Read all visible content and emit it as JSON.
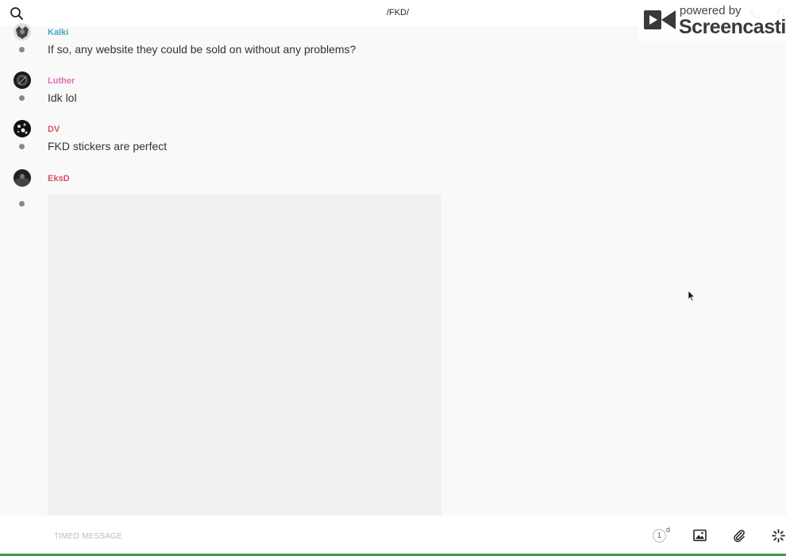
{
  "header": {
    "title": "/FKD/",
    "search_icon": "search-icon",
    "phone_icon": "phone-icon",
    "info_icon": "info-icon"
  },
  "watermark": {
    "top": "powered by",
    "bottom": "Screencastify"
  },
  "messages": [
    {
      "author": "Kalki",
      "author_color": "#4aa6c9",
      "text": "If so, any website they could be sold on without any problems?"
    },
    {
      "author": "Luther",
      "author_color": "#e36bb3",
      "text": "Idk lol"
    },
    {
      "author": "DV",
      "author_color": "#d6555f",
      "text": "FKD stickers are perfect"
    },
    {
      "author": "EksD",
      "author_color": "#d6555f",
      "text": ""
    }
  ],
  "composer": {
    "placeholder": "TIMED MESSAGE",
    "timer_value": "1",
    "timer_unit": "d",
    "photo_icon": "photo-icon",
    "attach_icon": "paperclip-icon",
    "burst_icon": "burst-icon"
  },
  "colors": {
    "background": "#f9f9f9",
    "bar": "#ffffff",
    "bottom_accent": "#3c9a55"
  }
}
